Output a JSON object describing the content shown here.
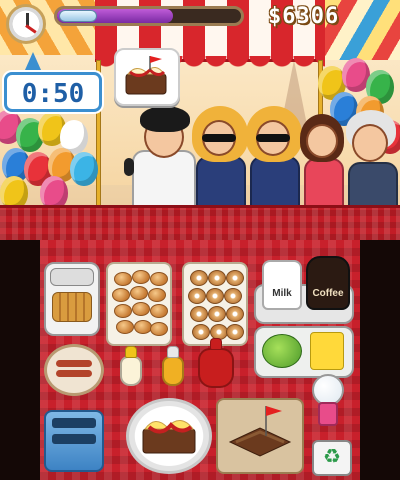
{
  "hud": {
    "money": "$6306",
    "timer": "0:50",
    "level_progress": 0.63
  },
  "icons": {
    "clock": "clock-icon",
    "recycle": "recycle-icon",
    "order_flag": "flag-icon"
  },
  "order": {
    "item": "brownie-sundae-with-flag"
  },
  "stations": {
    "milk_label": "Milk",
    "coffee_label": "Coffee"
  },
  "colors": {
    "counter_red": "#c21c26",
    "table_red": "#c8202b",
    "timer_blue": "#1f5fa6",
    "progress_purple": "#7a2aa3"
  }
}
